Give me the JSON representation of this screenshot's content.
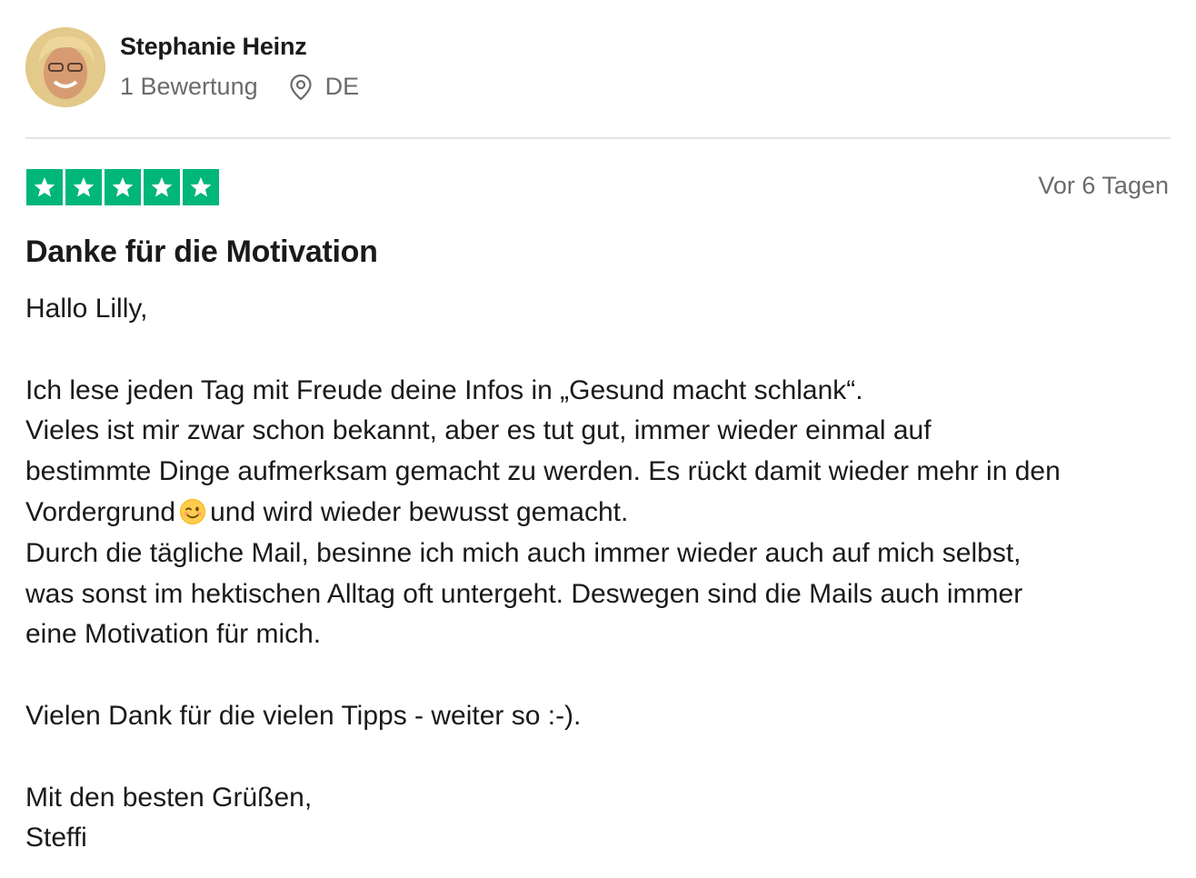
{
  "reviewer": {
    "name": "Stephanie Heinz",
    "review_count": "1 Bewertung",
    "location_icon": "location-pin-icon",
    "country": "DE"
  },
  "review": {
    "rating": 5,
    "rating_max": 5,
    "star_color": "#00b67a",
    "date": "Vor 6 Tagen",
    "title": "Danke für die Motivation",
    "lines": {
      "l1": "Hallo Lilly,",
      "l2": "Ich lese jeden Tag mit Freude deine Infos in „Gesund macht schlank“.",
      "l3": "Vieles ist mir zwar schon bekannt, aber es tut gut, immer wieder einmal auf",
      "l4": "bestimmte Dinge aufmerksam gemacht zu werden. Es rückt damit wieder mehr in den",
      "l5_before_emoji": "Vordergrund",
      "l5_emoji": "winking-face-emoji",
      "l5_after_emoji": "und wird wieder bewusst gemacht.",
      "l6": "Durch die tägliche Mail, besinne ich mich auch immer wieder auch auf mich selbst,",
      "l7": "was sonst im hektischen Alltag oft untergeht. Deswegen sind die Mails auch immer",
      "l8": "eine Motivation für mich.",
      "l9": "Vielen Dank für die vielen Tipps - weiter so :-).",
      "l10": "Mit den besten Grüßen,",
      "l11": "Steffi"
    }
  }
}
